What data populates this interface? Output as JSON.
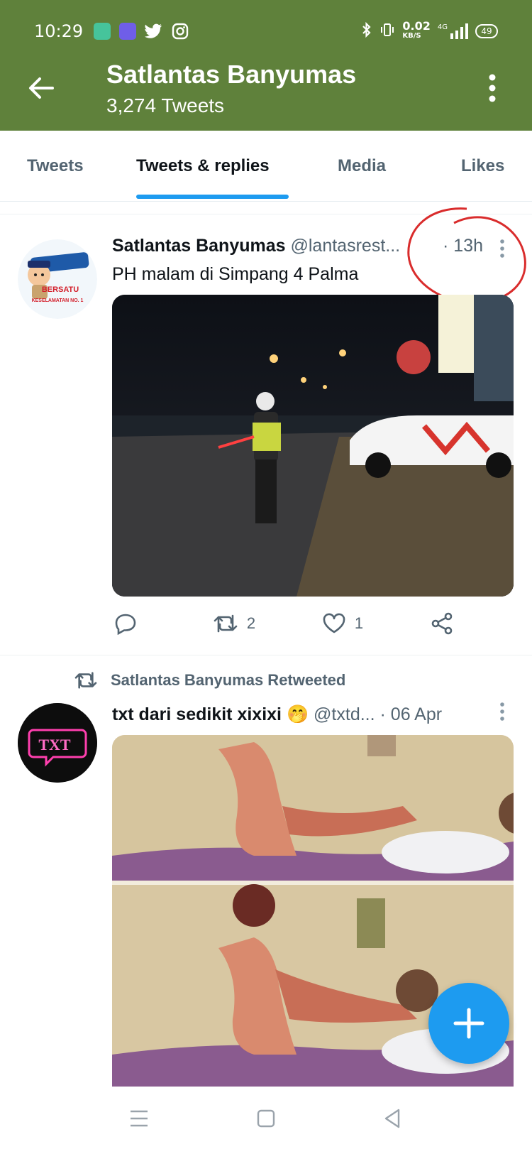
{
  "status_bar": {
    "time": "10:29",
    "speed": "0.02",
    "speed_unit": "KB/S",
    "network": "4G",
    "battery": "49",
    "icons": [
      "app-icon",
      "maps-icon",
      "twitter-icon",
      "instagram-icon",
      "bluetooth-icon",
      "vibrate-icon",
      "signal-icon",
      "battery-icon"
    ]
  },
  "header": {
    "title": "Satlantas Banyumas",
    "subtitle": "3,274 Tweets"
  },
  "tabs": [
    {
      "label": "Tweets"
    },
    {
      "label": "Tweets & replies"
    },
    {
      "label": "Media"
    },
    {
      "label": "Likes"
    }
  ],
  "active_tab": 1,
  "tweets": [
    {
      "name": "Satlantas Banyumas",
      "handle": "@lantasrest...",
      "time": "· 13h",
      "text": "PH malam di Simpang 4 Palma",
      "avatar_text": [
        "BERSATU",
        "KESELAMATAN NO. 1"
      ],
      "reply_count": "",
      "retweet_count": "2",
      "like_count": "1"
    },
    {
      "retweeted_by": "Satlantas Banyumas Retweeted",
      "name": "txt dari sedikit xixixi",
      "emoji": "🤭",
      "handle": "@txtd...",
      "time": "· 06 Apr",
      "avatar_text": "TXT"
    }
  ],
  "colors": {
    "header": "#5f813b",
    "accent": "#1d9bf0",
    "annotation": "#d92c2c"
  }
}
